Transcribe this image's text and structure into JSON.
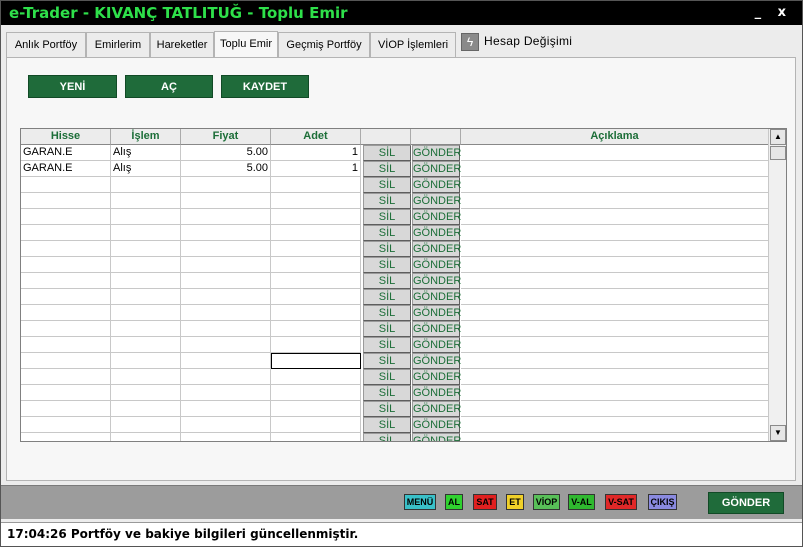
{
  "window": {
    "title": "e-Trader - KIVANÇ TATLITUĞ - Toplu Emir",
    "controls": "_ x"
  },
  "tabs": [
    {
      "label": "Anlık Portföy",
      "active": false
    },
    {
      "label": "Emirlerim",
      "active": false
    },
    {
      "label": "Hareketler",
      "active": false
    },
    {
      "label": "Toplu Emir",
      "active": true
    },
    {
      "label": "Geçmiş Portföy",
      "active": false
    },
    {
      "label": "VİOP İşlemleri",
      "active": false
    }
  ],
  "account_change": {
    "icon": "lightning-icon",
    "label": "Hesap Değişimi"
  },
  "toolbar": {
    "new_label": "YENİ",
    "open_label": "AÇ",
    "save_label": "KAYDET"
  },
  "grid": {
    "columns": [
      "Hisse",
      "İşlem",
      "Fiyat",
      "Adet",
      "",
      "",
      "Açıklama"
    ],
    "delete_label": "SİL",
    "send_label": "GÖNDER",
    "rows": [
      {
        "hisse": "GARAN.E",
        "islem": "Alış",
        "fiyat": "5.00",
        "adet": "1",
        "aciklama": ""
      },
      {
        "hisse": "GARAN.E",
        "islem": "Alış",
        "fiyat": "5.00",
        "adet": "1",
        "aciklama": ""
      },
      {
        "hisse": "",
        "islem": "",
        "fiyat": "",
        "adet": "",
        "aciklama": ""
      },
      {
        "hisse": "",
        "islem": "",
        "fiyat": "",
        "adet": "",
        "aciklama": ""
      },
      {
        "hisse": "",
        "islem": "",
        "fiyat": "",
        "adet": "",
        "aciklama": ""
      },
      {
        "hisse": "",
        "islem": "",
        "fiyat": "",
        "adet": "",
        "aciklama": ""
      },
      {
        "hisse": "",
        "islem": "",
        "fiyat": "",
        "adet": "",
        "aciklama": ""
      },
      {
        "hisse": "",
        "islem": "",
        "fiyat": "",
        "adet": "",
        "aciklama": ""
      },
      {
        "hisse": "",
        "islem": "",
        "fiyat": "",
        "adet": "",
        "aciklama": ""
      },
      {
        "hisse": "",
        "islem": "",
        "fiyat": "",
        "adet": "",
        "aciklama": ""
      },
      {
        "hisse": "",
        "islem": "",
        "fiyat": "",
        "adet": "",
        "aciklama": ""
      },
      {
        "hisse": "",
        "islem": "",
        "fiyat": "",
        "adet": "",
        "aciklama": ""
      },
      {
        "hisse": "",
        "islem": "",
        "fiyat": "",
        "adet": "",
        "aciklama": ""
      },
      {
        "hisse": "",
        "islem": "",
        "fiyat": "",
        "adet": "",
        "aciklama": ""
      },
      {
        "hisse": "",
        "islem": "",
        "fiyat": "",
        "adet": "",
        "aciklama": ""
      },
      {
        "hisse": "",
        "islem": "",
        "fiyat": "",
        "adet": "",
        "aciklama": ""
      },
      {
        "hisse": "",
        "islem": "",
        "fiyat": "",
        "adet": "",
        "aciklama": ""
      },
      {
        "hisse": "",
        "islem": "",
        "fiyat": "",
        "adet": "",
        "aciklama": ""
      },
      {
        "hisse": "",
        "islem": "",
        "fiyat": "",
        "adet": "",
        "aciklama": ""
      }
    ],
    "selected_row": 13
  },
  "quickbar": [
    {
      "label": "MENÜ",
      "bg": "#39c0c8",
      "fg": "#000000"
    },
    {
      "label": "AL",
      "bg": "#2fd12f",
      "fg": "#000000"
    },
    {
      "label": "SAT",
      "bg": "#e02020",
      "fg": "#000000"
    },
    {
      "label": "ET",
      "bg": "#f0d028",
      "fg": "#000000"
    },
    {
      "label": "VİOP",
      "bg": "#58c058",
      "fg": "#000000"
    },
    {
      "label": "V-AL",
      "bg": "#2fb82f",
      "fg": "#000000"
    },
    {
      "label": "V-SAT",
      "bg": "#e02828",
      "fg": "#000000"
    },
    {
      "label": "ÇIKIŞ",
      "bg": "#8a8ae0",
      "fg": "#000000"
    }
  ],
  "send_button_label": "GÖNDER",
  "status": {
    "time": "17:04:26",
    "message": "Portföy ve bakiye bilgileri güncellenmiştir."
  }
}
